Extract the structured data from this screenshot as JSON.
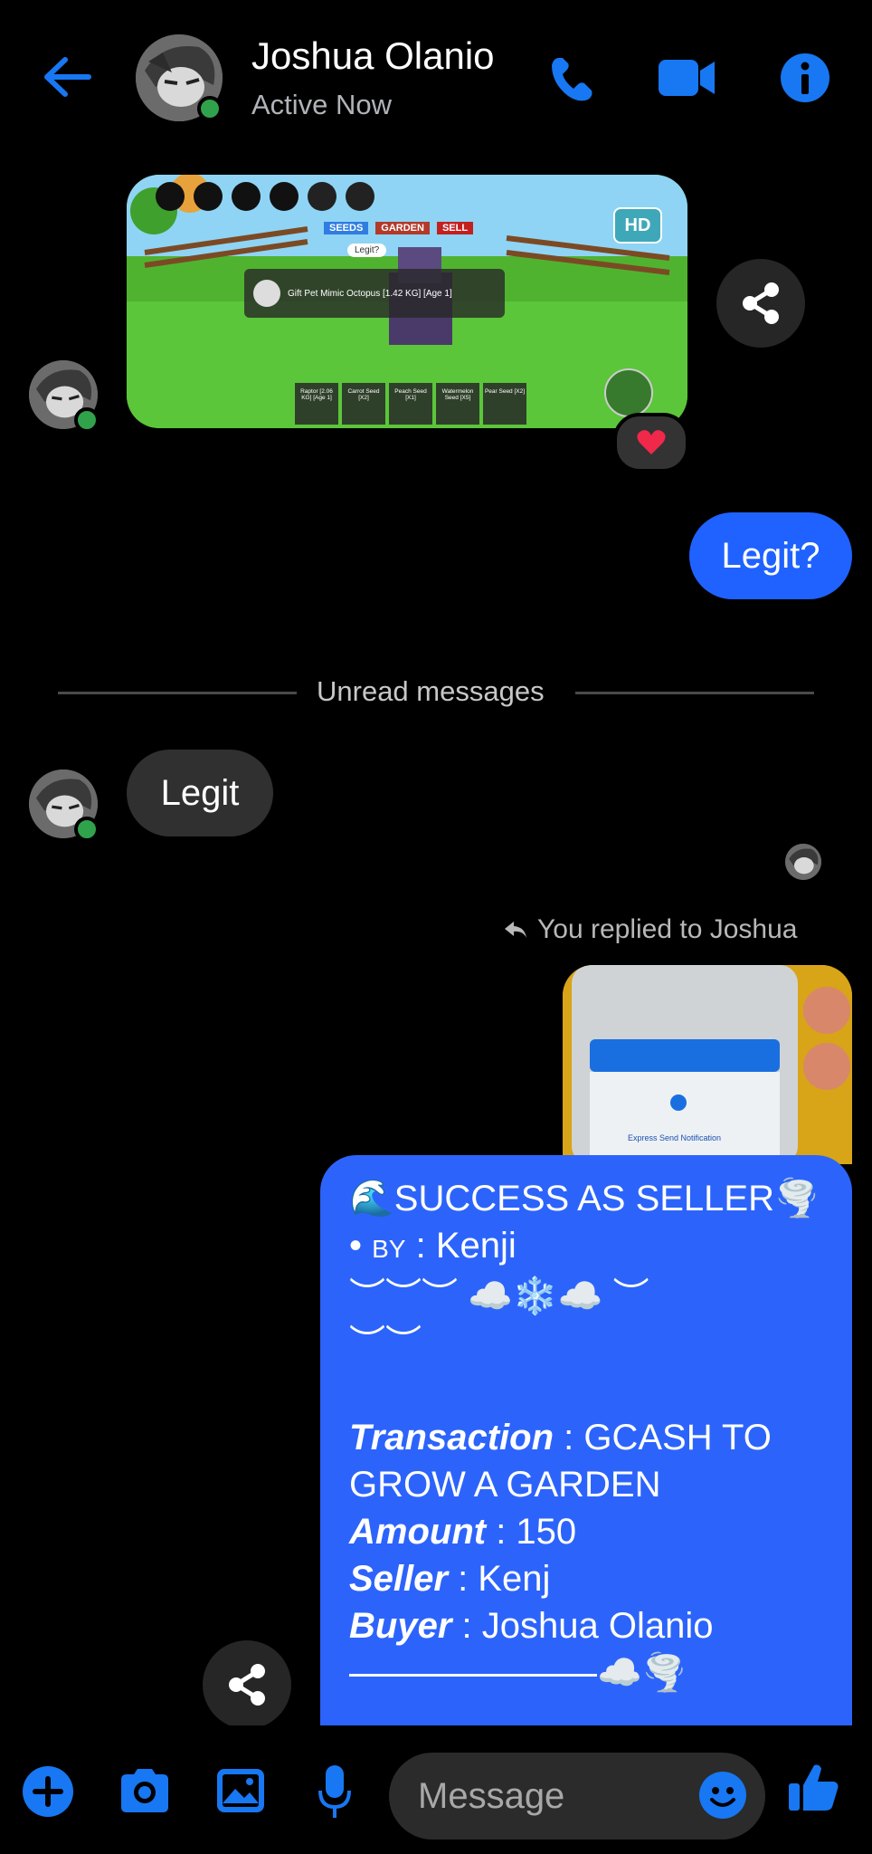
{
  "header": {
    "contact_name": "Joshua Olanio",
    "status": "Active Now",
    "icons": [
      "back-arrow-icon",
      "phone-icon",
      "video-camera-icon",
      "info-icon"
    ]
  },
  "game_screenshot": {
    "tabs": [
      "SEEDS",
      "GARDEN",
      "SELL"
    ],
    "bubble_text": "Legit?",
    "hd_label": "HD",
    "popup_title": "Gift Pet Mimic Octopus [1.42 KG] [Age 1]",
    "slots": [
      "Raptor [2.06 KG] [Age 1]",
      "Carrot Seed [X2]",
      "Peach Seed [X1]",
      "Watermelon Seed [X5]",
      "Pear Seed [X2]"
    ],
    "reaction": "heart"
  },
  "messages": {
    "outgoing_1": "Legit?",
    "divider": "Unread messages",
    "incoming_1": "Legit",
    "reply_label": "You replied to Joshua",
    "reply_preview_text": "Express Send Notification"
  },
  "seller_card": {
    "line1": "🌊SUCCESS AS SELLER🌪️",
    "line2_bullet": "• ",
    "line2_by": "BY",
    "line2_rest": " : Kenji",
    "line3": "︶︶︶ ☁️❄️☁️ ︶",
    "line4": "︶︶",
    "transaction_label": "Transaction",
    "transaction_value": " : GCASH TO GROW A GARDEN",
    "amount_label": "Amount",
    "amount_value": " : 150",
    "seller_label": "Seller",
    "seller_value": " : Kenj",
    "buyer_label": "Buyer",
    "buyer_value": " : Joshua Olanio",
    "footer": "☁️🌪️"
  },
  "composer": {
    "placeholder": "Message",
    "icons": [
      "plus-icon",
      "camera-icon",
      "gallery-icon",
      "microphone-icon",
      "emoji-icon",
      "thumbs-up-icon"
    ]
  },
  "colors": {
    "accent": "#1877f2",
    "bubble_out": "#1f62ff",
    "bubble_in": "#303030",
    "online": "#31a24c"
  }
}
